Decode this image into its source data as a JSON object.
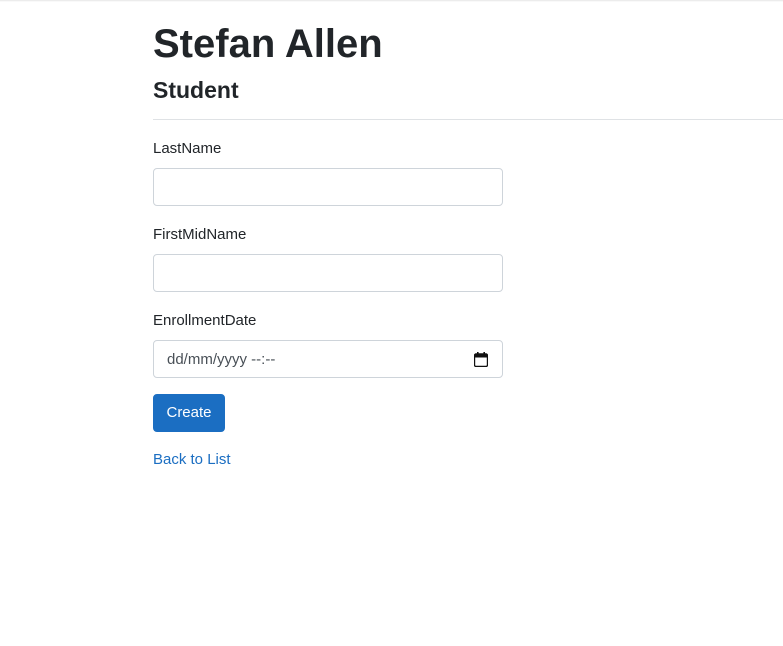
{
  "header": {
    "title": "Stefan Allen",
    "subtitle": "Student"
  },
  "form": {
    "last_name": {
      "label": "LastName",
      "value": "",
      "placeholder": ""
    },
    "first_mid_name": {
      "label": "FirstMidName",
      "value": "",
      "placeholder": ""
    },
    "enrollment_date": {
      "label": "EnrollmentDate",
      "placeholder": "dd/mm/yyyy  --:--",
      "icon": "calendar-icon"
    },
    "submit_label": "Create"
  },
  "nav": {
    "back_link": "Back to List"
  },
  "colors": {
    "primary": "#1b6ec2",
    "text": "#212529",
    "border": "#ced4da"
  }
}
